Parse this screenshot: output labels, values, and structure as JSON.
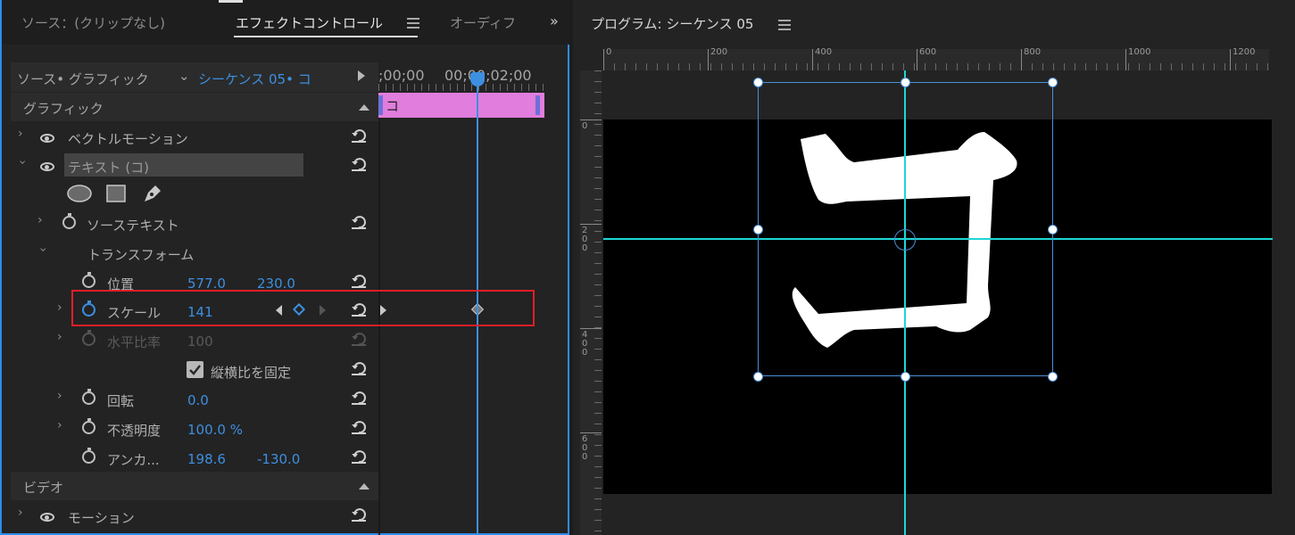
{
  "left_panel": {
    "tabs": [
      {
        "label": "ソース：(クリップなし)",
        "active": false
      },
      {
        "label": "エフェクトコントロール",
        "active": true
      },
      {
        "label": "オーディフ",
        "active": false
      }
    ],
    "tabs_more": "»",
    "source_label": "ソース• グラフィック",
    "sequence_label": "シーケンス 05• コ",
    "timeline": {
      "time_start": ";00;00",
      "time_marker": "00;00;02;00",
      "clip_label": "コ"
    },
    "sections": {
      "graphic": "グラフィック",
      "video": "ビデオ"
    },
    "layers": {
      "vector_motion": "ベクトルモーション",
      "text_layer": "テキスト (コ)"
    },
    "shape_tools": [
      "ellipse-icon",
      "rectangle-icon",
      "pen-icon"
    ],
    "properties": {
      "source_text": "ソーステキスト",
      "transform": "トランスフォーム",
      "position": {
        "label": "位置",
        "x": "577.0",
        "y": "230.0"
      },
      "scale": {
        "label": "スケール",
        "value": "141"
      },
      "h_scale": {
        "label": "水平比率",
        "value": "100"
      },
      "uniform": {
        "label": "縦横比を固定",
        "checked": true
      },
      "rotation": {
        "label": "回転",
        "value": "0.0"
      },
      "opacity": {
        "label": "不透明度",
        "value": "100.0 %"
      },
      "anchor": {
        "label": "アンカ...",
        "x": "198.6",
        "y": "-130.0"
      },
      "motion": "モーション"
    }
  },
  "program_monitor": {
    "title": "プログラム: シーケンス 05",
    "h_ruler": [
      "0",
      "200",
      "400",
      "600",
      "800",
      "1000",
      "1200"
    ],
    "v_ruler": [
      "0",
      "200",
      "400",
      "600"
    ],
    "canvas_text": "コ"
  },
  "colors": {
    "accent": "#3d8fe0",
    "clip": "#e07ddd",
    "guide": "#1fd6d6",
    "highlight": "#e01f26"
  }
}
